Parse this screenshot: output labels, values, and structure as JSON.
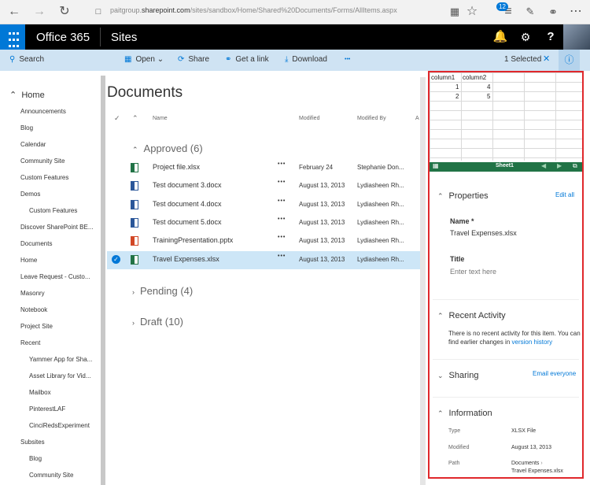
{
  "browser": {
    "url_prefix": "paitgroup.",
    "url_domain": "sharepoint.com",
    "url_path": "/sites/sandbox/Home/Shared%20Documents/Forms/AllItems.aspx"
  },
  "suite": {
    "app_name": "Office 365",
    "site_name": "Sites",
    "notification_count": "12"
  },
  "commands": {
    "search": "Search",
    "open": "Open",
    "share": "Share",
    "get_link": "Get a link",
    "download": "Download",
    "more": "•••",
    "selected": "1 Selected"
  },
  "nav": {
    "home": "Home",
    "items": [
      {
        "label": "Announcements",
        "indent": 0
      },
      {
        "label": "Blog",
        "indent": 0
      },
      {
        "label": "Calendar",
        "indent": 0
      },
      {
        "label": "Community Site",
        "indent": 0
      },
      {
        "label": "Custom Features",
        "indent": 0
      },
      {
        "label": "Demos",
        "indent": 0
      },
      {
        "label": "Custom Features",
        "indent": 1
      },
      {
        "label": "Discover SharePoint BE...",
        "indent": 0
      },
      {
        "label": "Documents",
        "indent": 0
      },
      {
        "label": "Home",
        "indent": 0
      },
      {
        "label": "Leave Request - Custo...",
        "indent": 0
      },
      {
        "label": "Masonry",
        "indent": 0
      },
      {
        "label": "Notebook",
        "indent": 0
      },
      {
        "label": "Project Site",
        "indent": 0
      },
      {
        "label": "Recent",
        "indent": 0
      },
      {
        "label": "Yammer App for Sha...",
        "indent": 1
      },
      {
        "label": "Asset Library for Vid...",
        "indent": 1
      },
      {
        "label": "Mailbox",
        "indent": 1
      },
      {
        "label": "PinterestLAF",
        "indent": 1
      },
      {
        "label": "CinciRedsExperiment",
        "indent": 1
      },
      {
        "label": "Subsites",
        "indent": 0
      },
      {
        "label": "Blog",
        "indent": 1
      },
      {
        "label": "Community Site",
        "indent": 1
      }
    ]
  },
  "main": {
    "title": "Documents",
    "columns": {
      "name": "Name",
      "modified": "Modified",
      "modified_by": "Modified By",
      "extra": "A"
    },
    "groups": {
      "approved": "Approved (6)",
      "pending": "Pending (4)",
      "draft": "Draft (10)"
    },
    "files": [
      {
        "name": "Project file.xlsx",
        "type": "xlsx",
        "modified": "February 24",
        "by": "Stephanie Don...",
        "selected": false
      },
      {
        "name": "Test document 3.docx",
        "type": "docx",
        "modified": "August 13, 2013",
        "by": "Lydiasheen Rh...",
        "selected": false
      },
      {
        "name": "Test document 4.docx",
        "type": "docx",
        "modified": "August 13, 2013",
        "by": "Lydiasheen Rh...",
        "selected": false
      },
      {
        "name": "Test document 5.docx",
        "type": "docx",
        "modified": "August 13, 2013",
        "by": "Lydiasheen Rh...",
        "selected": false
      },
      {
        "name": "TrainingPresentation.pptx",
        "type": "pptx",
        "modified": "August 13, 2013",
        "by": "Lydiasheen Rh...",
        "selected": false
      },
      {
        "name": "Travel Expenses.xlsx",
        "type": "xlsx",
        "modified": "August 13, 2013",
        "by": "Lydiasheen Rh...",
        "selected": true
      }
    ]
  },
  "preview": {
    "headers": [
      "column1",
      "column2"
    ],
    "rows": [
      [
        "1",
        "4"
      ],
      [
        "2",
        "5"
      ]
    ],
    "sheet_tab": "Sheet1"
  },
  "details": {
    "properties_heading": "Properties",
    "edit_all": "Edit all",
    "name_label": "Name *",
    "name_value": "Travel Expenses.xlsx",
    "title_label": "Title",
    "title_placeholder": "Enter text here",
    "activity_heading": "Recent Activity",
    "activity_text": "There is no recent activity for this item. You can find earlier changes in",
    "activity_link": "version history",
    "sharing_heading": "Sharing",
    "email_everyone": "Email everyone",
    "info_heading": "Information",
    "type_key": "Type",
    "type_value": "XLSX File",
    "modified_key": "Modified",
    "modified_value": "August 13, 2013",
    "path_key": "Path",
    "path_value_1": "Documents",
    "path_value_2": "Travel Expenses.xlsx"
  },
  "colors": {
    "accent": "#0078d7",
    "excel_green": "#217346",
    "word_blue": "#2b579a",
    "ppt_red": "#d24726",
    "selection": "#cde6f7",
    "panel_border": "#e0282c"
  }
}
